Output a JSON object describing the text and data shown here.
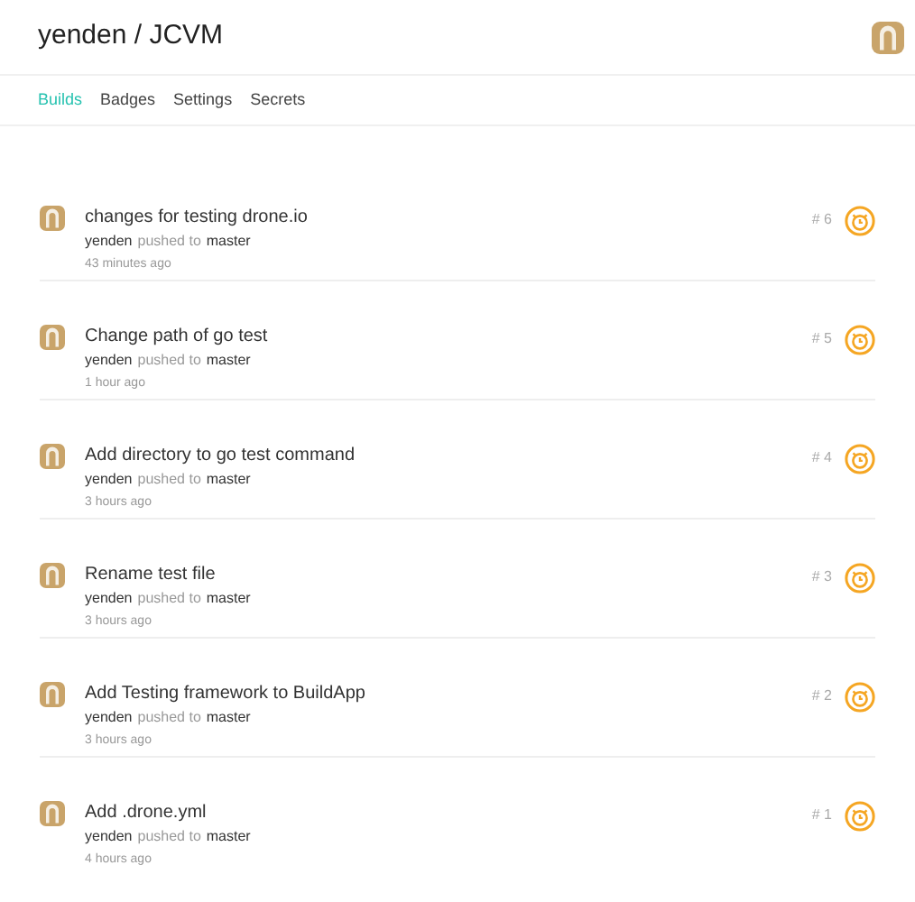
{
  "header": {
    "title": "yenden / JCVM"
  },
  "tabs": [
    {
      "label": "Builds",
      "selected": true
    },
    {
      "label": "Badges",
      "selected": false
    },
    {
      "label": "Settings",
      "selected": false
    },
    {
      "label": "Secrets",
      "selected": false
    }
  ],
  "builds": [
    {
      "message": "changes for testing drone.io",
      "author": "yenden",
      "action": "pushed to",
      "branch": "master",
      "time": "43 minutes ago",
      "number": "# 6"
    },
    {
      "message": "Change path of go test",
      "author": "yenden",
      "action": "pushed to",
      "branch": "master",
      "time": "1 hour ago",
      "number": "# 5"
    },
    {
      "message": "Add directory to go test command",
      "author": "yenden",
      "action": "pushed to",
      "branch": "master",
      "time": "3 hours ago",
      "number": "# 4"
    },
    {
      "message": "Rename test file",
      "author": "yenden",
      "action": "pushed to",
      "branch": "master",
      "time": "3 hours ago",
      "number": "# 3"
    },
    {
      "message": "Add Testing framework to BuildApp",
      "author": "yenden",
      "action": "pushed to",
      "branch": "master",
      "time": "3 hours ago",
      "number": "# 2"
    },
    {
      "message": "Add .drone.yml",
      "author": "yenden",
      "action": "pushed to",
      "branch": "master",
      "time": "4 hours ago",
      "number": "# 1"
    }
  ]
}
